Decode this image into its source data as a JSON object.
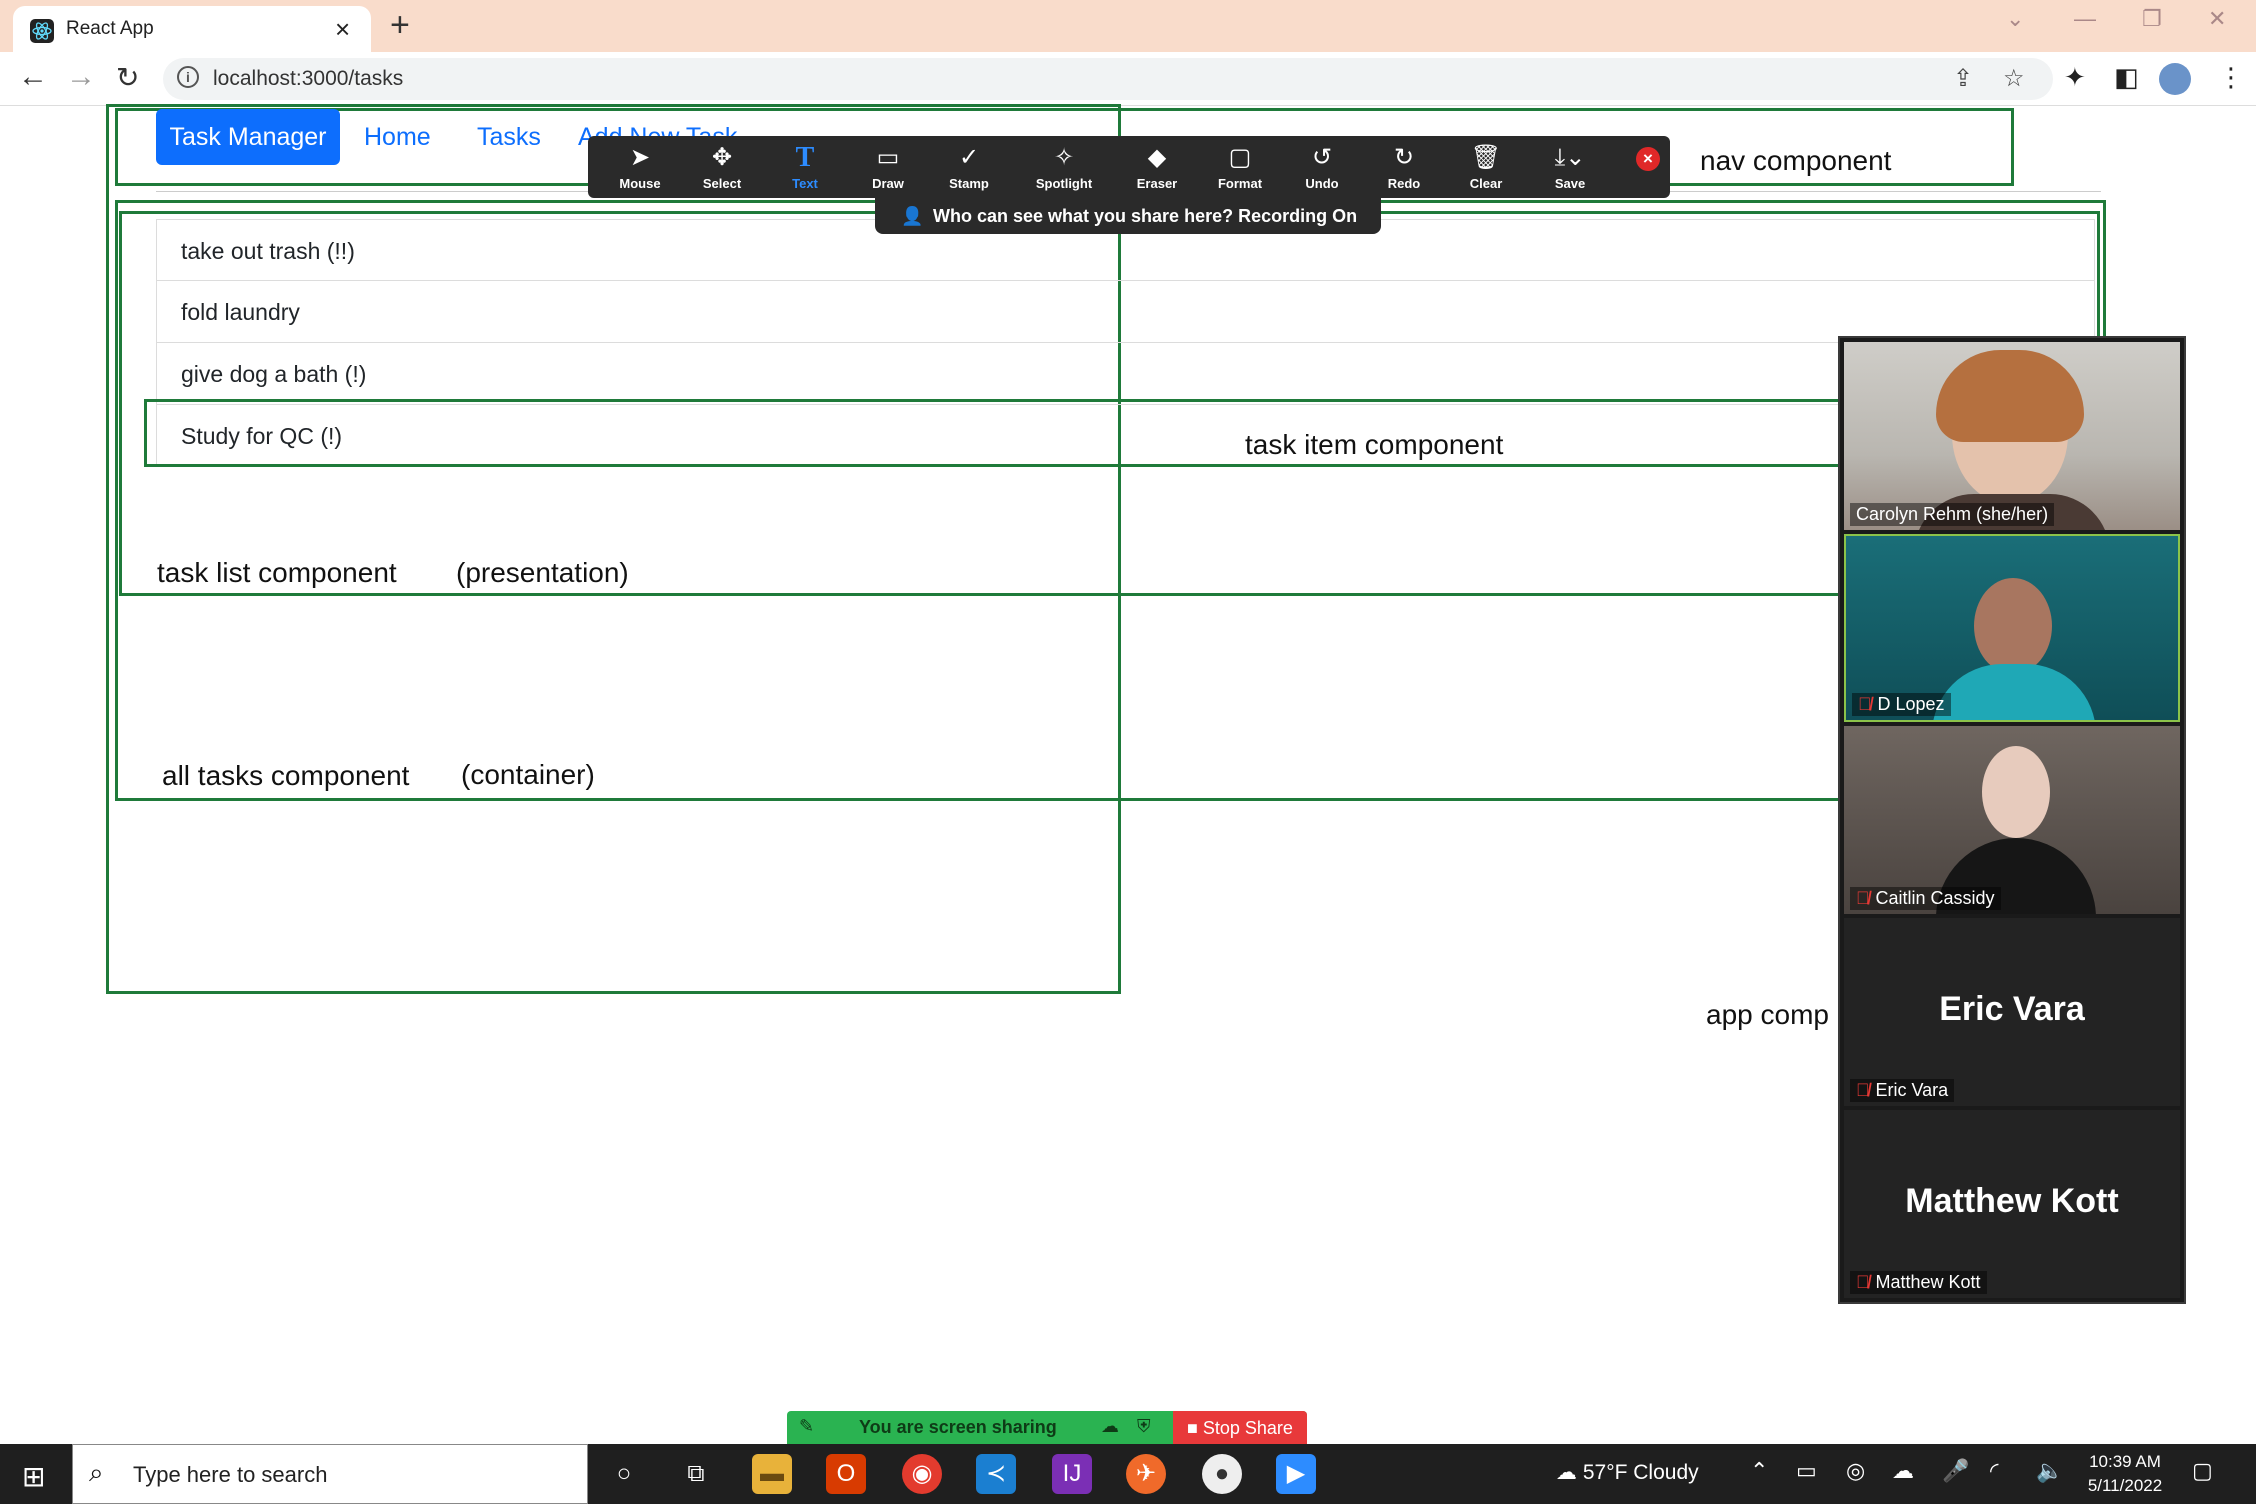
{
  "browser": {
    "tab_title": "React App",
    "url": "localhost:3000/tasks"
  },
  "nav": {
    "brand": "Task Manager",
    "links": [
      "Home",
      "Tasks",
      "Add New Task"
    ]
  },
  "tasks": [
    "take out trash (!!)",
    "fold laundry",
    "give dog a bath (!)",
    "Study for QC (!)"
  ],
  "annotations": {
    "nav_component": "nav component",
    "task_item_component": "task item component",
    "task_list_component": "task list component",
    "task_list_note": "(presentation)",
    "all_tasks_component": "all tasks component",
    "all_tasks_note": "(container)",
    "app_component": "app comp"
  },
  "annotate_toolbar": {
    "tools": [
      {
        "label": "Mouse",
        "icon": "mouse-pointer-icon"
      },
      {
        "label": "Select",
        "icon": "move-icon"
      },
      {
        "label": "Text",
        "icon": "text-icon"
      },
      {
        "label": "Draw",
        "icon": "draw-rect-icon"
      },
      {
        "label": "Stamp",
        "icon": "checkmark-icon"
      },
      {
        "label": "Spotlight",
        "icon": "spotlight-icon"
      },
      {
        "label": "Eraser",
        "icon": "eraser-icon"
      },
      {
        "label": "Format",
        "icon": "format-icon"
      },
      {
        "label": "Undo",
        "icon": "undo-icon"
      },
      {
        "label": "Redo",
        "icon": "redo-icon"
      },
      {
        "label": "Clear",
        "icon": "trash-icon"
      },
      {
        "label": "Save",
        "icon": "save-icon"
      }
    ],
    "active_tool": "Text",
    "share_notice": "Who can see what you share here? Recording On"
  },
  "participants": [
    {
      "name": "Carolyn Rehm (she/her)",
      "muted": false,
      "video": true
    },
    {
      "name": "D Lopez",
      "muted": true,
      "video": true,
      "active_speaker": true
    },
    {
      "name": "Caitlin Cassidy",
      "muted": true,
      "video": true
    },
    {
      "name": "Eric Vara",
      "muted": true,
      "video": false
    },
    {
      "name": "Matthew Kott",
      "muted": true,
      "video": false
    }
  ],
  "sharing_bar": {
    "status": "You are screen sharing",
    "stop_label": "Stop Share"
  },
  "taskbar": {
    "search_placeholder": "Type here to search",
    "weather": "57°F  Cloudy",
    "time": "10:39 AM",
    "date": "5/11/2022"
  },
  "colors": {
    "annotation_green": "#1f7a3a",
    "bootstrap_primary": "#0d6efd",
    "zoom_blue": "#2d8cff",
    "share_green": "#2ab351",
    "stop_red": "#e8393a"
  }
}
